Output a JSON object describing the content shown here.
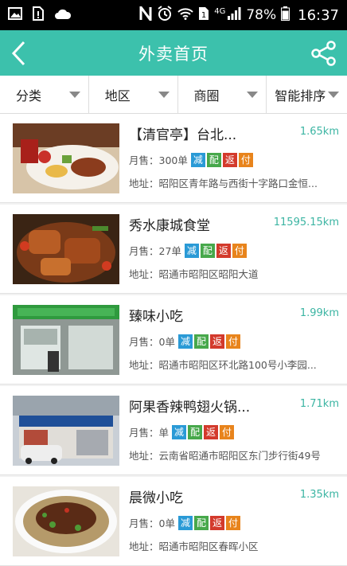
{
  "status_bar": {
    "battery": "78%",
    "time": "16:37",
    "network": "4G",
    "icons": [
      "image-icon",
      "sim-alert-icon",
      "cloud-icon",
      "nfc-icon",
      "vibrate-icon",
      "wifi-icon",
      "sim-1-icon",
      "signal-icon",
      "battery-icon"
    ]
  },
  "header": {
    "title": "外卖首页"
  },
  "filters": [
    {
      "label": "分类"
    },
    {
      "label": "地区"
    },
    {
      "label": "商圈"
    },
    {
      "label": "智能排序"
    }
  ],
  "badges": {
    "jian": "减",
    "pei": "配",
    "fan": "返",
    "fu": "付"
  },
  "colors": {
    "accent": "#3cc1ac",
    "distance": "#3cb5a3",
    "jian": "#2a9ad6",
    "pei": "#47a84b",
    "fan": "#d33a2c",
    "fu": "#e8841c"
  },
  "restaurants": [
    {
      "name": "【清官亭】台北...",
      "distance": "1.65km",
      "sales": "月售：300单",
      "address": "地址：昭阳区青年路与西街十字路口金恒..."
    },
    {
      "name": "秀水康城食堂",
      "distance": "11595.15km",
      "sales": "月售：27单",
      "address": "地址：昭通市昭阳区昭阳大道"
    },
    {
      "name": "臻味小吃",
      "distance": "1.99km",
      "sales": "月售：0单",
      "address": "地址：昭通市昭阳区环北路100号小李园..."
    },
    {
      "name": "阿果香辣鸭翅火锅...",
      "distance": "1.71km",
      "sales": "月售：单",
      "address": "地址：云南省昭通市昭阳区东门步行街49号"
    },
    {
      "name": "晨微小吃",
      "distance": "1.35km",
      "sales": "月售：0单",
      "address": "地址：昭通市昭阳区春晖小区"
    }
  ]
}
